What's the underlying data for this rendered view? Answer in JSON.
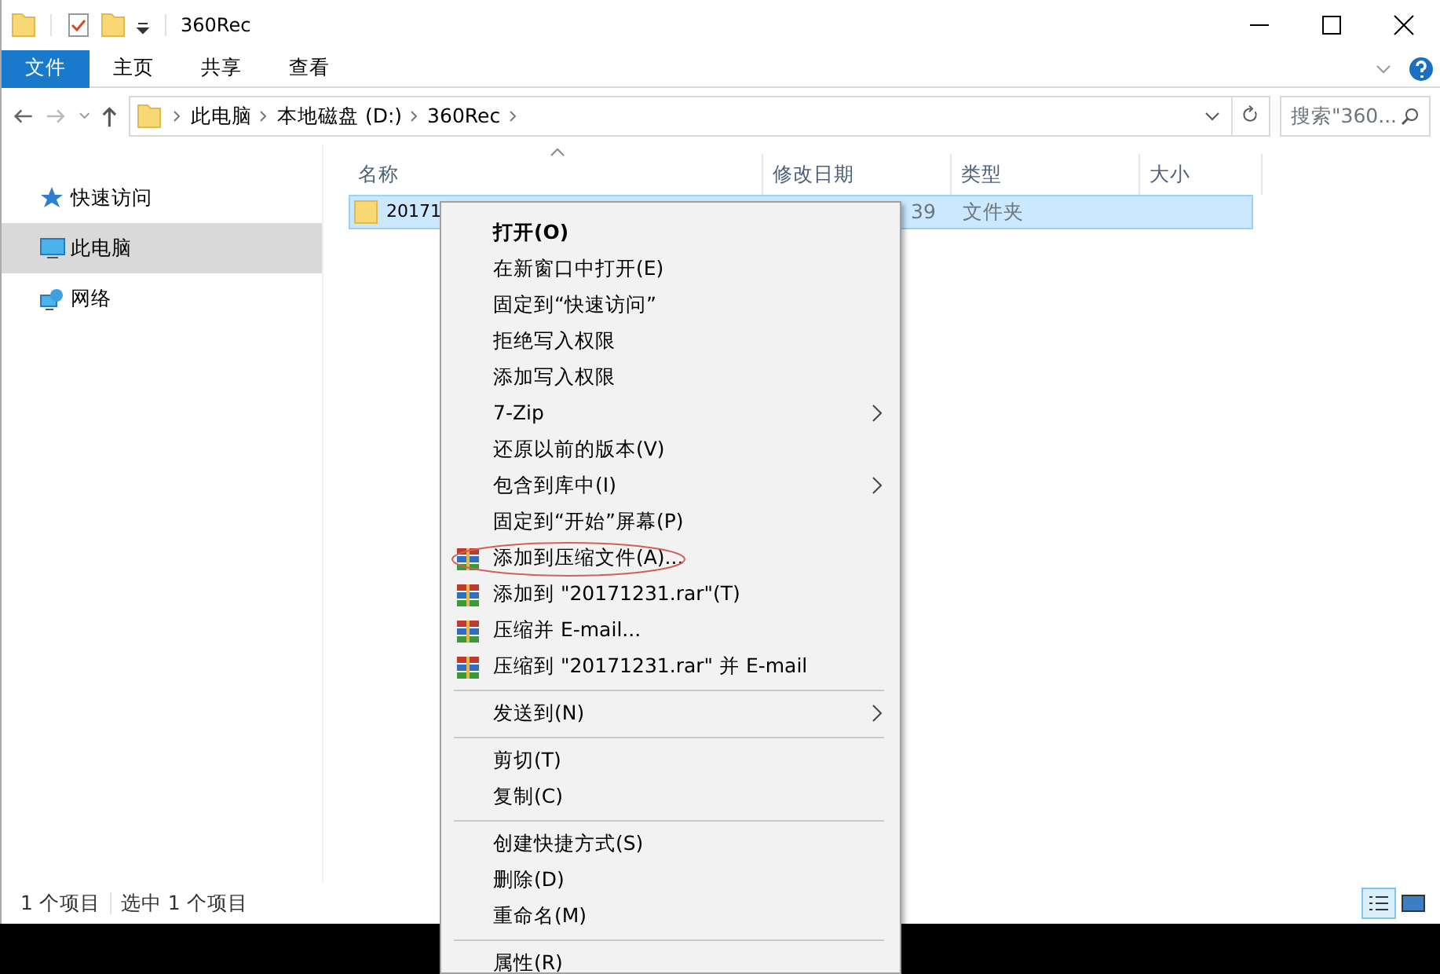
{
  "window": {
    "title": "360Rec"
  },
  "ribbon_tabs": [
    {
      "label": "文件",
      "selected": true
    },
    {
      "label": "主页",
      "selected": false
    },
    {
      "label": "共享",
      "selected": false
    },
    {
      "label": "查看",
      "selected": false
    }
  ],
  "address_bar": {
    "crumbs": [
      "此电脑",
      "本地磁盘 (D:)",
      "360Rec"
    ]
  },
  "search": {
    "placeholder": "搜索\"360..."
  },
  "sidebar": {
    "items": [
      {
        "label": "快速访问",
        "selected": false
      },
      {
        "label": "此电脑",
        "selected": true
      },
      {
        "label": "网络",
        "selected": false
      }
    ]
  },
  "table": {
    "columns": [
      "名称",
      "修改日期",
      "类型",
      "大小"
    ],
    "rows": [
      {
        "name": "20171",
        "modified": "39",
        "type": "文件夹",
        "selected": true
      }
    ]
  },
  "context_menu": [
    {
      "kind": "item",
      "label": "打开(O)",
      "bold": true
    },
    {
      "kind": "item",
      "label": "在新窗口中打开(E)"
    },
    {
      "kind": "item",
      "label": "固定到“快速访问”"
    },
    {
      "kind": "item",
      "label": "拒绝写入权限"
    },
    {
      "kind": "item",
      "label": "添加写入权限"
    },
    {
      "kind": "item",
      "label": "7-Zip",
      "submenu": true
    },
    {
      "kind": "item",
      "label": "还原以前的版本(V)"
    },
    {
      "kind": "item",
      "label": "包含到库中(I)",
      "submenu": true
    },
    {
      "kind": "item",
      "label": "固定到“开始”屏幕(P)"
    },
    {
      "kind": "archive",
      "label": "添加到压缩文件(A)...",
      "circled": true
    },
    {
      "kind": "archive",
      "label": "添加到 \"20171231.rar\"(T)"
    },
    {
      "kind": "archive",
      "label": "压缩并 E-mail..."
    },
    {
      "kind": "archive",
      "label": "压缩到 \"20171231.rar\" 并 E-mail"
    },
    {
      "kind": "separator"
    },
    {
      "kind": "item",
      "label": "发送到(N)",
      "submenu": true
    },
    {
      "kind": "separator"
    },
    {
      "kind": "item",
      "label": "剪切(T)"
    },
    {
      "kind": "item",
      "label": "复制(C)"
    },
    {
      "kind": "separator"
    },
    {
      "kind": "item",
      "label": "创建快捷方式(S)"
    },
    {
      "kind": "item",
      "label": "删除(D)"
    },
    {
      "kind": "item",
      "label": "重命名(M)"
    },
    {
      "kind": "separator"
    },
    {
      "kind": "item",
      "label": "属性(R)"
    }
  ],
  "status_bar": {
    "item_count": "1 个项目",
    "selection": "选中 1 个项目",
    "views": [
      {
        "kind": "details",
        "selected": true
      },
      {
        "kind": "large-icons",
        "selected": false
      }
    ]
  }
}
